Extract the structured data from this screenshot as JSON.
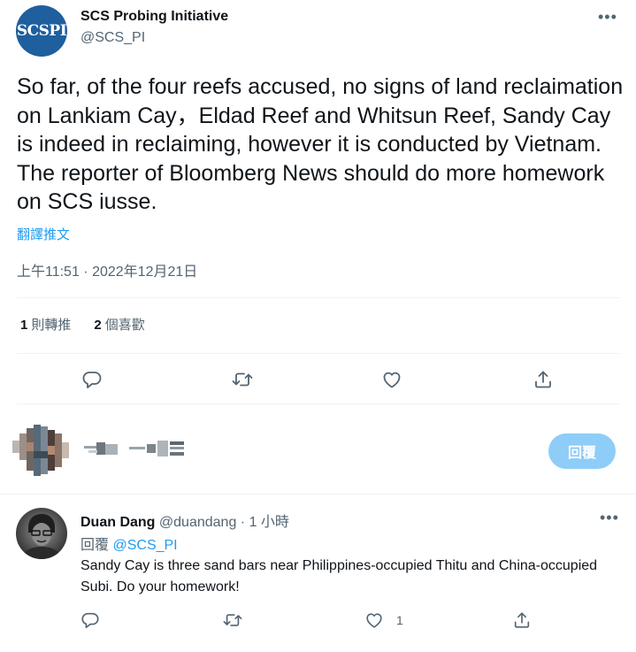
{
  "tweet": {
    "avatar_text": "SCSPI",
    "display_name": "SCS Probing Initiative",
    "handle": "@SCS_PI",
    "more_label": "•••",
    "text": "So far, of the four reefs accused, no signs of land reclaimation on Lankiam Cay，Eldad Reef and Whitsun Reef, Sandy Cay is indeed in reclaiming, however it is conducted by Vietnam. The reporter of Bloomberg News should do more homework on SCS iusse.",
    "translate_label": "翻譯推文",
    "timestamp": "上午11:51 · 2022年12月21日"
  },
  "stats": {
    "retweets_count": "1",
    "retweets_label": "則轉推",
    "likes_count": "2",
    "likes_label": "個喜歡"
  },
  "compose": {
    "reply_button_label": "回覆"
  },
  "reply": {
    "display_name": "Duan Dang",
    "handle": "@duandang",
    "separator": "·",
    "time_ago": "1 小時",
    "more_label": "•••",
    "replying_prefix": "回覆",
    "replying_to": "@SCS_PI",
    "text": "Sandy Cay is three sand bars near Philippines-occupied Thitu and China-occupied Subi. Do your homework!",
    "like_count": "1"
  },
  "icons": [
    "reply-icon",
    "retweet-icon",
    "like-icon",
    "share-icon"
  ],
  "colors": {
    "accent": "#1d9bf0",
    "reply_button": "#8ecdf8",
    "muted_text": "#536471",
    "avatar_brand": "#1f5f9e"
  }
}
